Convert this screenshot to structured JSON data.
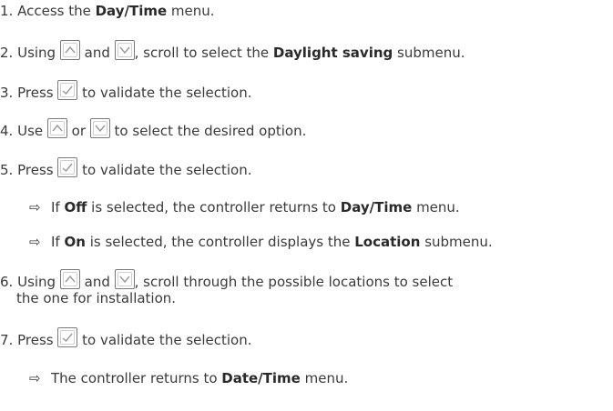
{
  "steps": [
    {
      "num": "1.",
      "a": "Access the ",
      "b": "Day/Time",
      "c": " menu."
    },
    {
      "num": "2.",
      "a": "Using ",
      "and": " and ",
      "b1": ", scroll to select the ",
      "bold": "Daylight saving",
      "c": " submenu."
    },
    {
      "num": "3.",
      "a": "Press ",
      "b": " to validate the selection."
    },
    {
      "num": "4.",
      "a": "Use ",
      "or": " or ",
      "b": " to select the desired option."
    },
    {
      "num": "5.",
      "a": "Press ",
      "b": " to validate the selection."
    },
    {
      "num": "6.",
      "a": "Using ",
      "and": " and ",
      "b": ", scroll through the possible locations to select",
      "cont": "the one for installation."
    },
    {
      "num": "7.",
      "a": "Press ",
      "b": " to validate the selection."
    }
  ],
  "results": [
    {
      "arrow": "⇨",
      "a": "If ",
      "b": "Off",
      "c": " is selected, the controller returns to ",
      "d": "Day/Time",
      "e": " menu."
    },
    {
      "arrow": "⇨",
      "a": "If ",
      "b": "On",
      "c": " is selected, the controller displays the ",
      "d": "Location",
      "e": " submenu."
    },
    {
      "arrow": "⇨",
      "a": "The controller returns to ",
      "b": "Date/Time",
      "c": " menu."
    }
  ],
  "icons": {
    "up": "up-arrow-button-icon",
    "down": "down-arrow-button-icon",
    "ok": "check-button-icon"
  }
}
